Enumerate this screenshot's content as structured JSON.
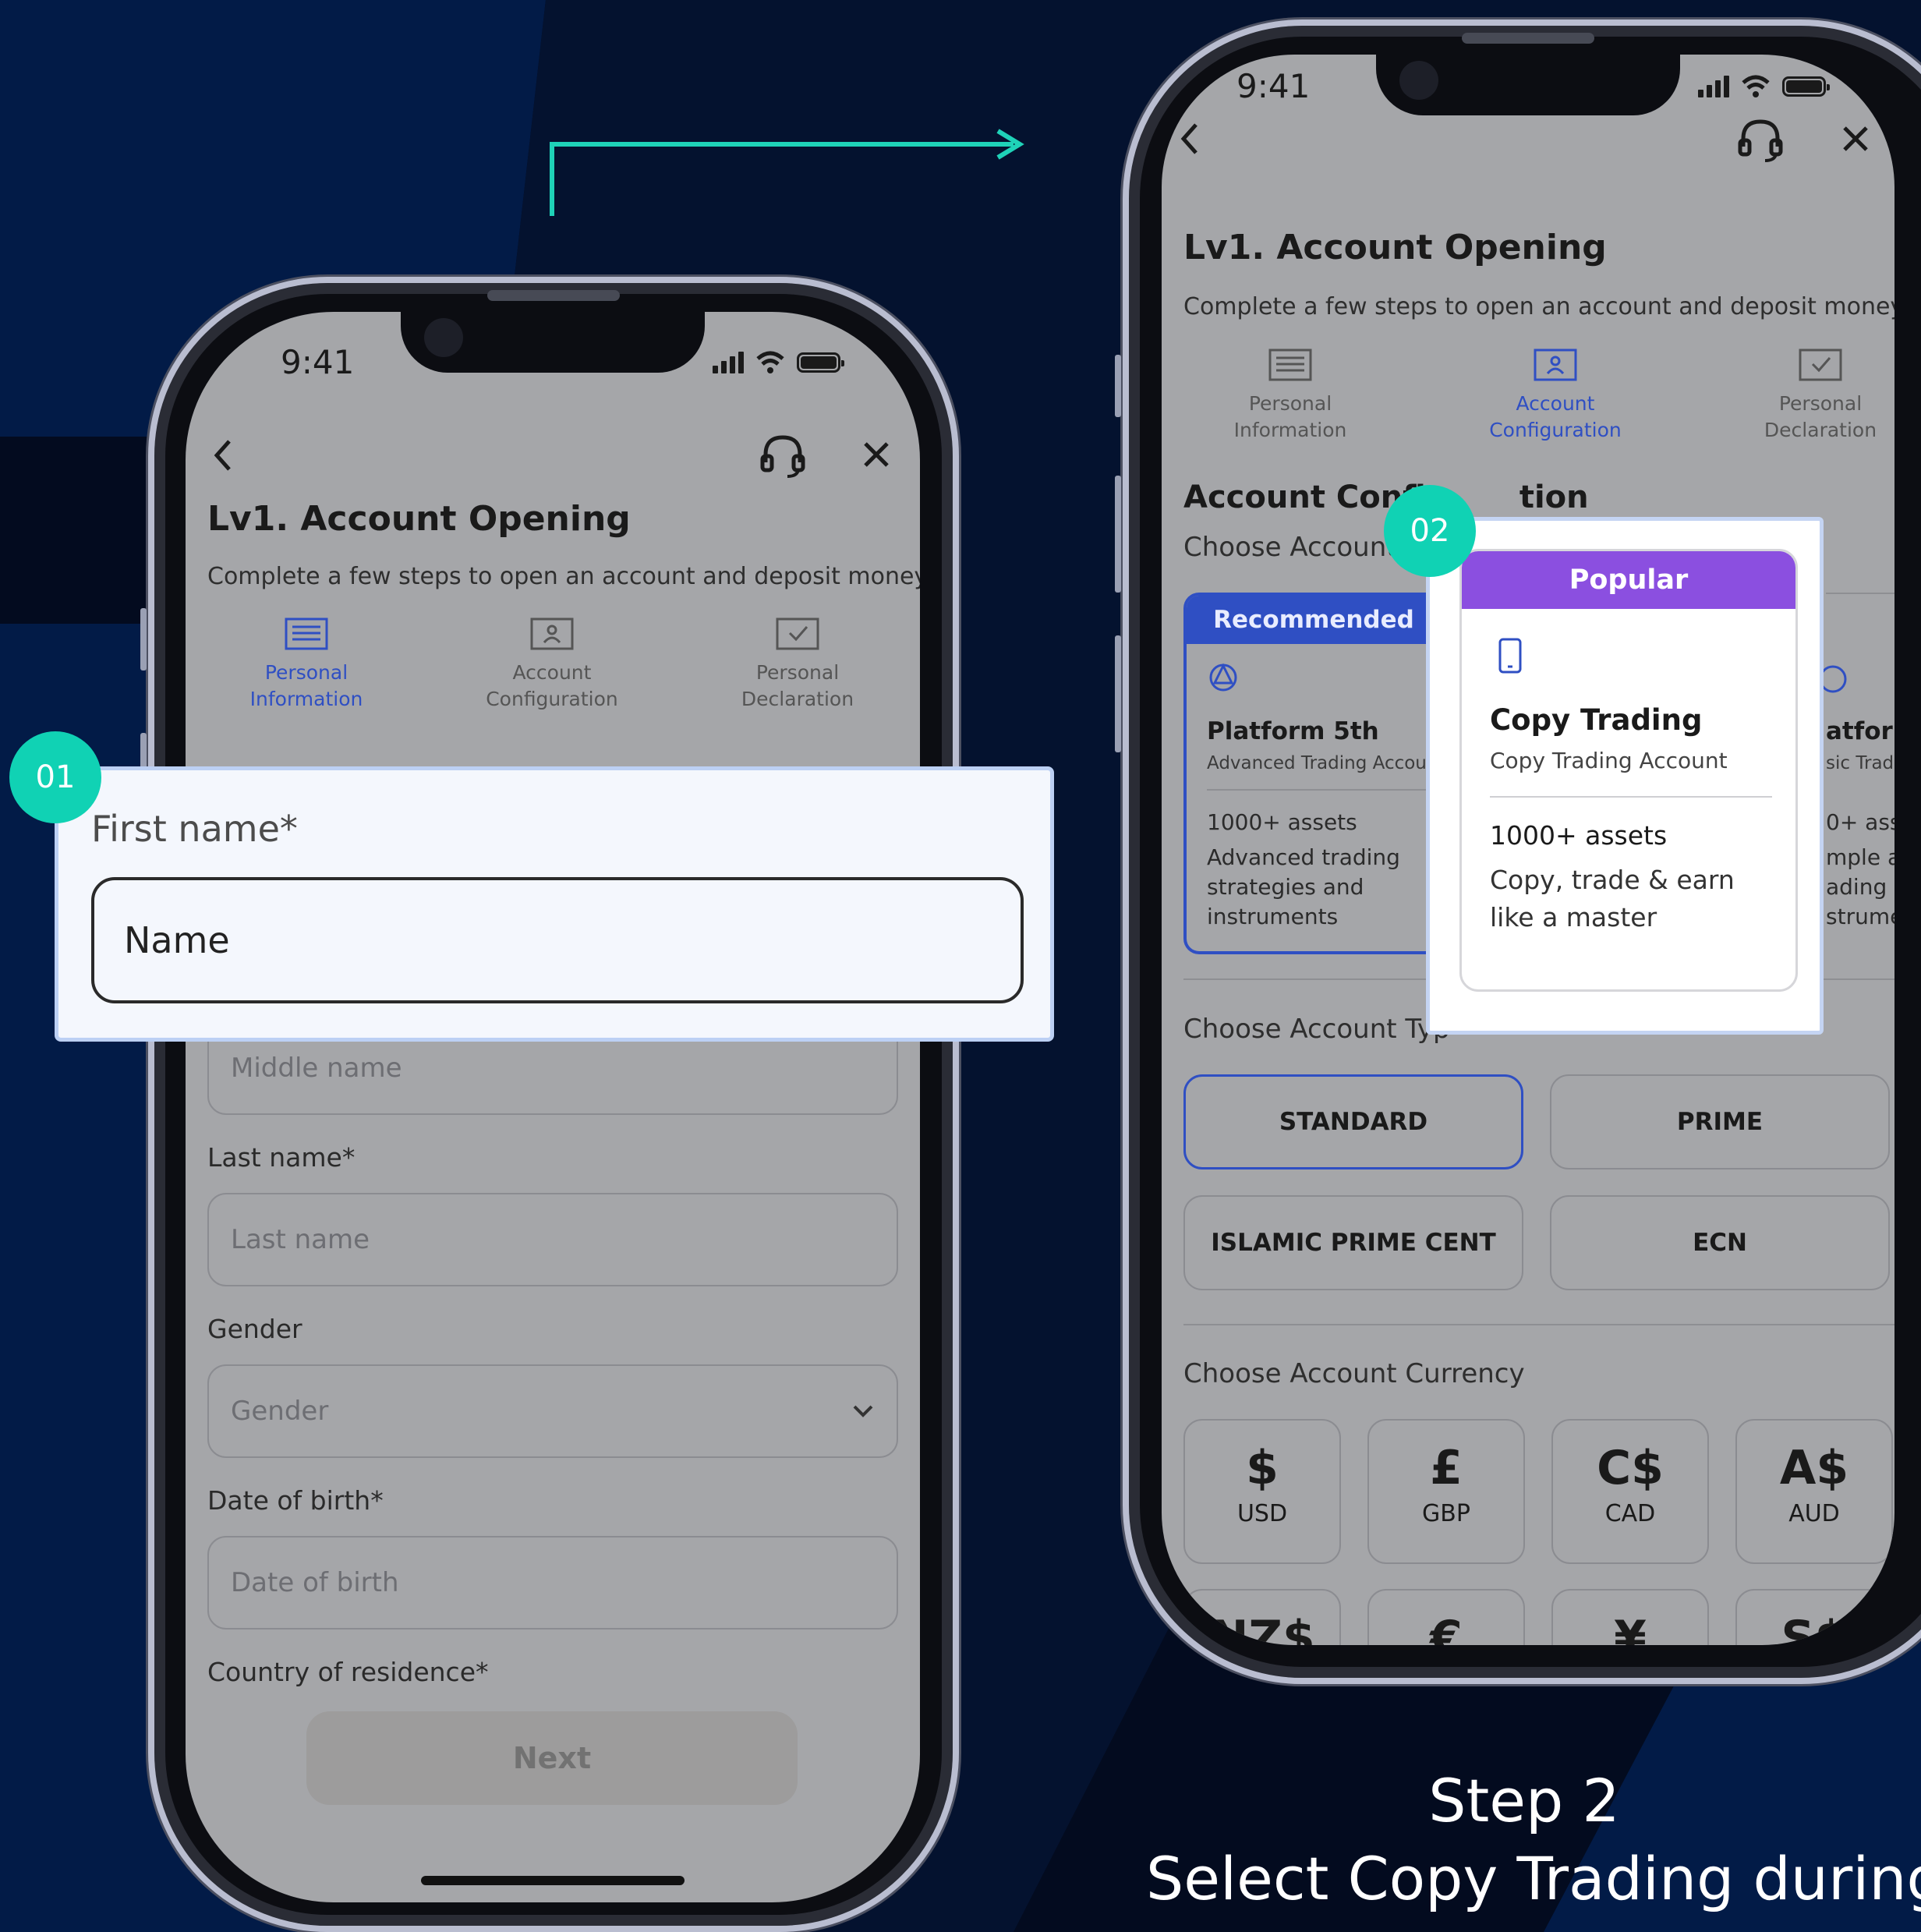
{
  "colors": {
    "background": "#030b1f",
    "accent_teal": "#10d2b4",
    "brand_blue": "#2f4fc3",
    "popular_purple": "#8b4fe0",
    "screen_overlay_gray": "#a5a6a9"
  },
  "left_phone": {
    "time": "9:41",
    "icons": [
      "back-chevron-icon",
      "headset-icon",
      "close-icon",
      "signal-icon",
      "wifi-icon",
      "battery-icon"
    ],
    "title": "Lv1. Account Opening",
    "subtitle": "Complete a few steps to open an account and deposit money",
    "steps": [
      {
        "line1": "Personal",
        "line2": "Information",
        "active": true
      },
      {
        "line1": "Account",
        "line2": "Configuration",
        "active": false
      },
      {
        "line1": "Personal",
        "line2": "Declaration",
        "active": false
      }
    ],
    "form": {
      "middle_name_placeholder": "Middle name",
      "last_name_label": "Last name*",
      "last_name_placeholder": "Last name",
      "gender_label": "Gender",
      "gender_value": "Gender",
      "dob_label": "Date of birth*",
      "dob_placeholder": "Date of birth",
      "country_label": "Country of residence*",
      "next_button": "Next"
    }
  },
  "callout_1": {
    "badge": "01",
    "label": "First name*",
    "input_value": "Name"
  },
  "right_phone": {
    "time": "9:41",
    "title": "Lv1. Account Opening",
    "subtitle": "Complete a few steps to open an account and deposit money",
    "steps": [
      {
        "line1": "Personal",
        "line2": "Information",
        "active": false
      },
      {
        "line1": "Account",
        "line2": "Configuration",
        "active": true
      },
      {
        "line1": "Personal",
        "line2": "Declaration",
        "active": false
      }
    ],
    "section_title": "Account Confi",
    "section_title_tail": "tion",
    "choose_platform": "Choose Account",
    "platform_card": {
      "ribbon": "Recommended",
      "name": "Platform 5th",
      "sub": "Advanced Trading Account",
      "assets": "1000+ assets",
      "desc_lines": [
        "Advanced trading",
        "strategies and",
        "instruments"
      ]
    },
    "platform_card_right_partial": {
      "name": "atforn",
      "sub": "sic Tradi",
      "assets": "0+ ass",
      "desc_lines": [
        "mple ar",
        "ading s",
        "strumer"
      ]
    },
    "choose_type": "Choose Account Typ",
    "account_types": [
      "STANDARD",
      "PRIME",
      "ISLAMIC PRIME CENT",
      "ECN"
    ],
    "choose_currency": "Choose Account Currency",
    "currencies": [
      {
        "symbol": "$",
        "code": "USD"
      },
      {
        "symbol": "£",
        "code": "GBP"
      },
      {
        "symbol": "C$",
        "code": "CAD"
      },
      {
        "symbol": "A$",
        "code": "AUD"
      }
    ],
    "currencies_row2": [
      "NZ$",
      "€",
      "¥",
      "S$"
    ]
  },
  "callout_2": {
    "badge": "02",
    "ribbon": "Popular",
    "name": "Copy Trading",
    "sub": "Copy Trading Account",
    "assets": "1000+ assets",
    "desc": "Copy, trade & earn like a master"
  },
  "caption": {
    "line1": "Step 2",
    "line2": "Select Copy Trading during"
  }
}
